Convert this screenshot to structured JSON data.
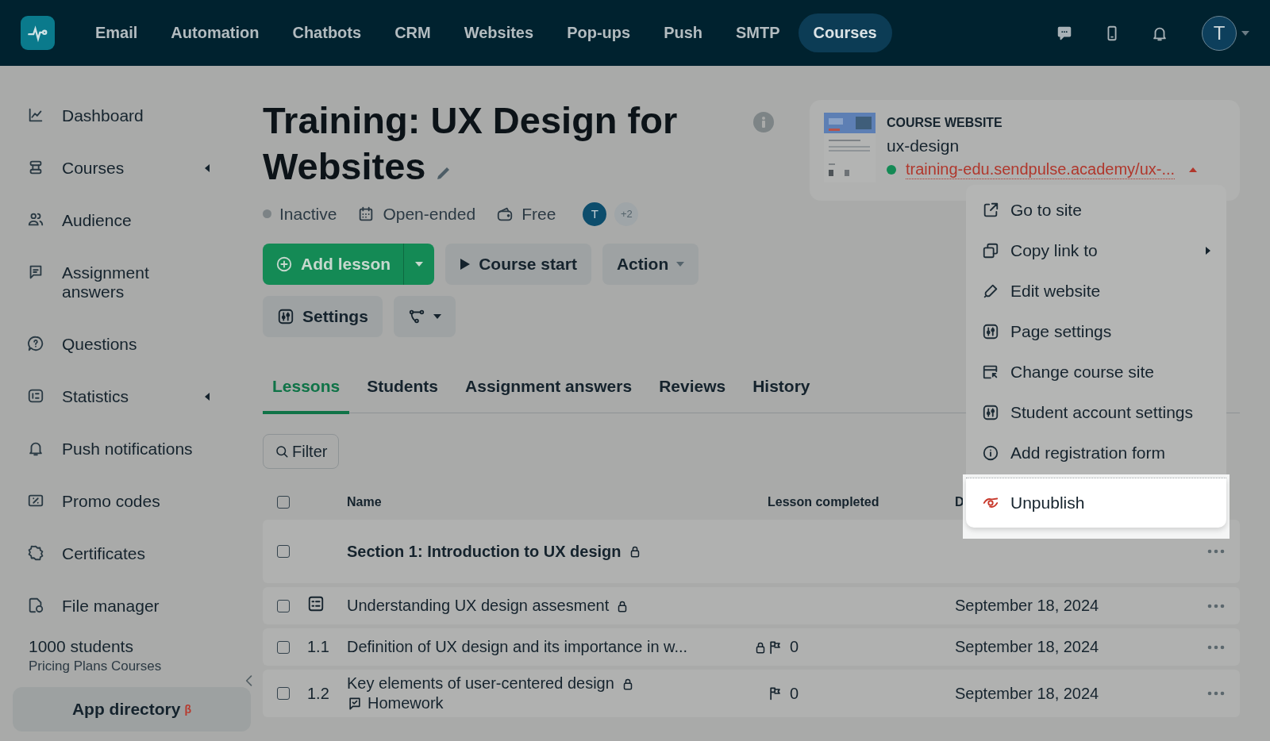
{
  "nav": {
    "items": [
      {
        "label": "Email",
        "selected": false
      },
      {
        "label": "Automation",
        "selected": false
      },
      {
        "label": "Chatbots",
        "selected": false
      },
      {
        "label": "CRM",
        "selected": false
      },
      {
        "label": "Websites",
        "selected": false
      },
      {
        "label": "Pop-ups",
        "selected": false
      },
      {
        "label": "Push",
        "selected": false
      },
      {
        "label": "SMTP",
        "selected": false
      },
      {
        "label": "Courses",
        "selected": true
      }
    ],
    "avatar": "T"
  },
  "sidebar": {
    "items": [
      {
        "label": "Dashboard",
        "expandable": false
      },
      {
        "label": "Courses",
        "expandable": true
      },
      {
        "label": "Audience",
        "expandable": false
      },
      {
        "label": "Assignment answers",
        "expandable": false
      },
      {
        "label": "Questions",
        "expandable": false
      },
      {
        "label": "Statistics",
        "expandable": true
      },
      {
        "label": "Push notifications",
        "expandable": false
      },
      {
        "label": "Promo codes",
        "expandable": false
      },
      {
        "label": "Certificates",
        "expandable": false
      },
      {
        "label": "File manager",
        "expandable": false
      }
    ],
    "plan": {
      "title": "1000 students",
      "subtitle": "Pricing Plans Courses"
    },
    "app_directory": {
      "label": "App directory",
      "badge": "β"
    }
  },
  "course": {
    "title": "Training: UX Design for Websites",
    "active": false,
    "status": "Inactive",
    "duration": "Open-ended",
    "price": "Free",
    "avatar": "T",
    "more_members": "+2",
    "buttons": {
      "add_lesson": "Add lesson",
      "course_start": "Course start",
      "action": "Action",
      "settings": "Settings"
    }
  },
  "website": {
    "heading": "COURSE WEBSITE",
    "name": "ux-design",
    "url": "training-edu.sendpulse.academy/ux-...",
    "published": true
  },
  "menu": {
    "items": [
      {
        "label": "Go to site",
        "kind": "normal",
        "submenu": false,
        "highlighted": false
      },
      {
        "label": "Copy link to",
        "kind": "normal",
        "submenu": true,
        "highlighted": false
      },
      {
        "label": "Edit website",
        "kind": "normal",
        "submenu": false,
        "highlighted": false
      },
      {
        "label": "Page settings",
        "kind": "normal",
        "submenu": false,
        "highlighted": false
      },
      {
        "label": "Change course site",
        "kind": "normal",
        "submenu": false,
        "highlighted": false
      },
      {
        "label": "Student account settings",
        "kind": "normal",
        "submenu": false,
        "highlighted": false
      },
      {
        "label": "Add registration form",
        "kind": "normal",
        "submenu": false,
        "highlighted": false
      },
      {
        "label": "Unpublish",
        "kind": "danger",
        "submenu": false,
        "highlighted": true
      }
    ]
  },
  "tabs": [
    {
      "label": "Lessons",
      "selected": true
    },
    {
      "label": "Students",
      "selected": false
    },
    {
      "label": "Assignment answers",
      "selected": false
    },
    {
      "label": "Reviews",
      "selected": false
    },
    {
      "label": "History",
      "selected": false
    }
  ],
  "filter": "Filter",
  "table": {
    "checked": false,
    "columns": [
      "Name",
      "Lesson completed",
      "D"
    ],
    "rows": [
      {
        "kind": "section",
        "name": "Section 1: Introduction to UX design",
        "locked": true,
        "checked": false
      },
      {
        "kind": "test",
        "name": "Understanding UX design assesment",
        "locked": true,
        "checked": false,
        "date": "September 18, 2024"
      },
      {
        "kind": "lesson",
        "number": "1.1",
        "name": "Definition of UX design and its importance in w...",
        "locked": true,
        "checked": false,
        "completed": "0",
        "date": "September 18, 2024"
      },
      {
        "kind": "lesson",
        "number": "1.2",
        "name": "Key elements of user-centered design",
        "locked": true,
        "checked": false,
        "completed": "0",
        "date": "September 18, 2024",
        "homework": "Homework"
      }
    ]
  }
}
